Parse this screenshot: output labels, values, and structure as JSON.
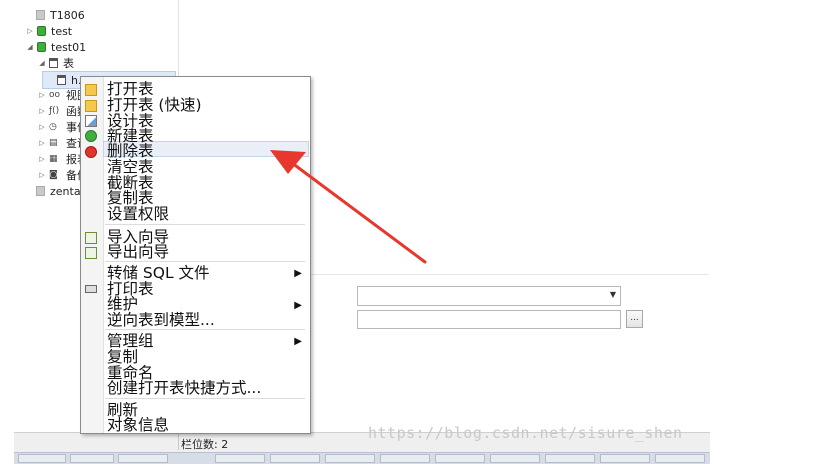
{
  "tree": {
    "items": [
      {
        "label": "T1806"
      },
      {
        "label": "test"
      },
      {
        "label": "test01"
      },
      {
        "label": "表"
      },
      {
        "label": "h..."
      },
      {
        "label": "视图"
      },
      {
        "label": "函数"
      },
      {
        "label": "事件"
      },
      {
        "label": "查询"
      },
      {
        "label": "报表"
      },
      {
        "label": "备份"
      },
      {
        "label": "zenta"
      }
    ]
  },
  "context_menu": {
    "items": [
      {
        "label": "打开表"
      },
      {
        "label": "打开表 (快速)"
      },
      {
        "label": "设计表"
      },
      {
        "label": "新建表"
      },
      {
        "label": "删除表"
      },
      {
        "label": "清空表"
      },
      {
        "label": "截断表"
      },
      {
        "label": "复制表"
      },
      {
        "label": "设置权限"
      },
      {
        "label": "导入向导"
      },
      {
        "label": "导出向导"
      },
      {
        "label": "转储 SQL 文件"
      },
      {
        "label": "打印表"
      },
      {
        "label": "维护"
      },
      {
        "label": "逆向表到模型..."
      },
      {
        "label": "管理组"
      },
      {
        "label": "复制"
      },
      {
        "label": "重命名"
      },
      {
        "label": "创建打开表快捷方式..."
      },
      {
        "label": "刷新"
      },
      {
        "label": "对象信息"
      }
    ]
  },
  "form": {
    "browse_button": "..."
  },
  "status": {
    "columns": "栏位数: 2"
  },
  "watermark": "https://blog.csdn.net/sisure_shen",
  "colors": {
    "arrow": "#e8372c",
    "highlight": "#e9eef7"
  }
}
